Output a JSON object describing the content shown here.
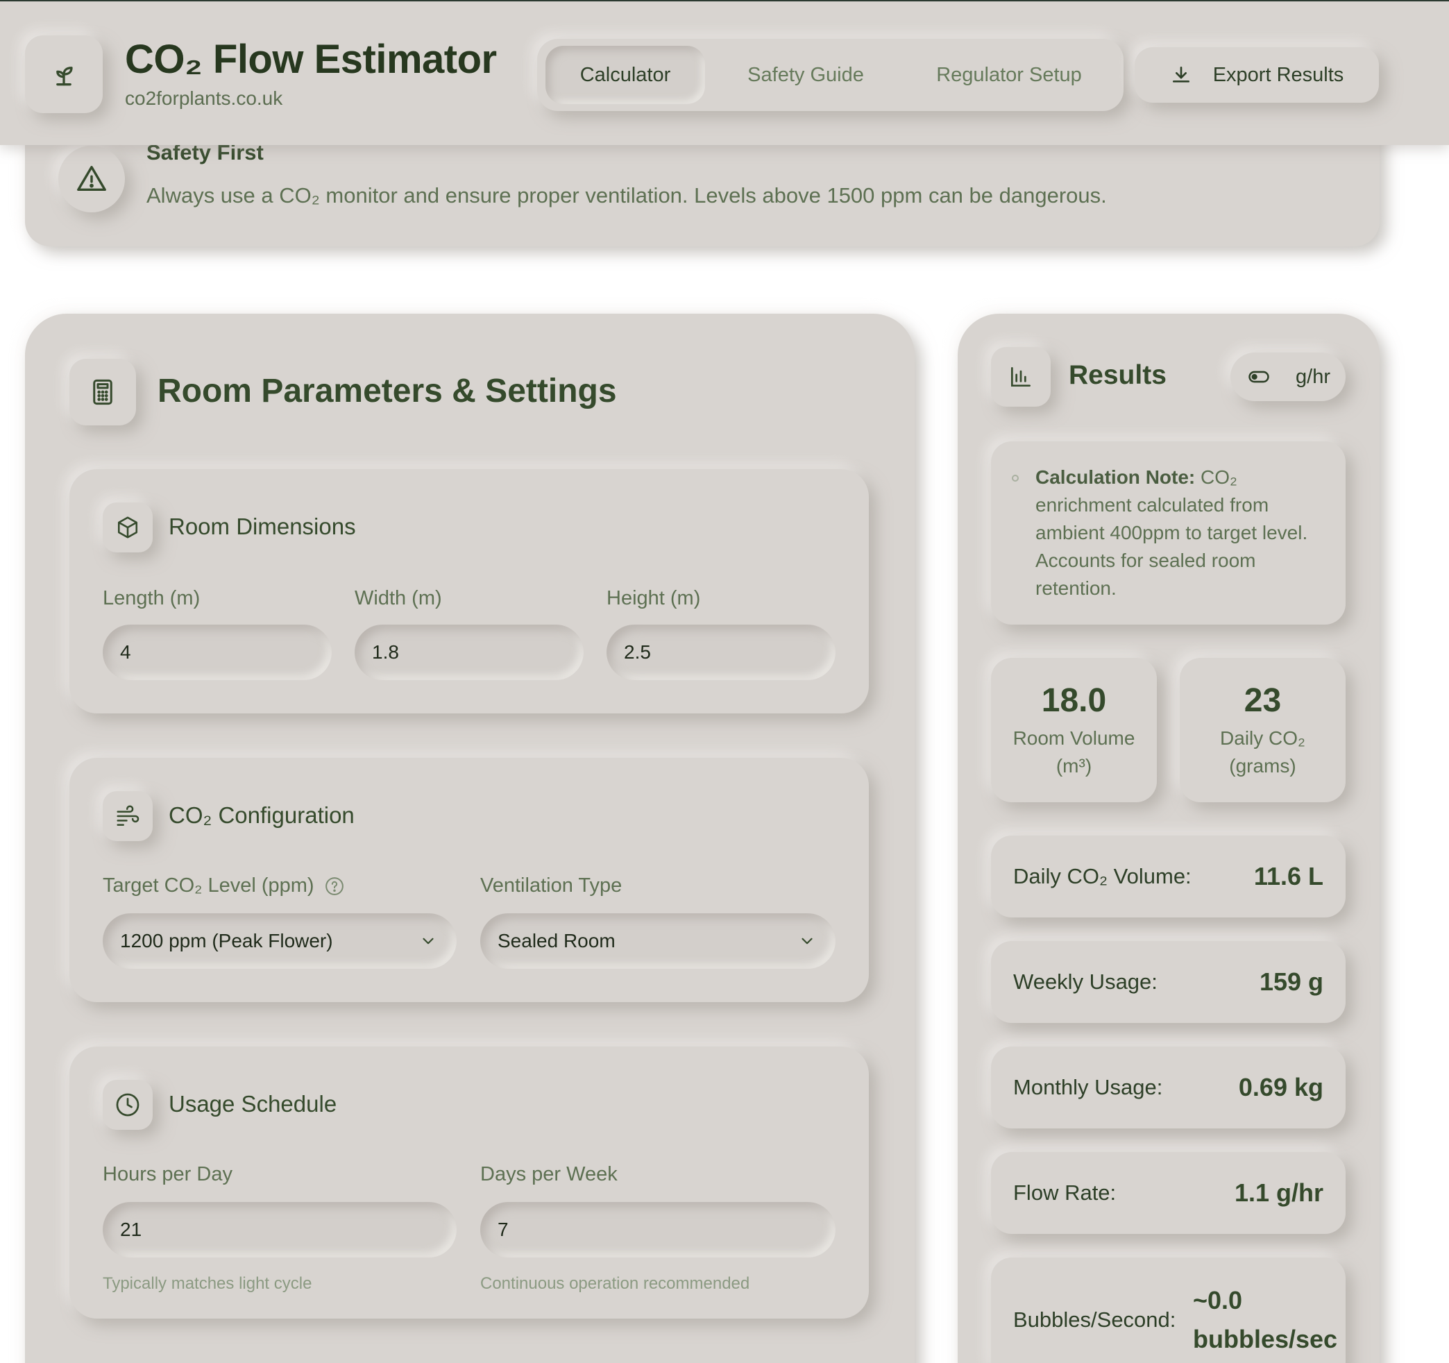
{
  "header": {
    "title": "CO₂ Flow Estimator",
    "subtitle": "co2forplants.co.uk",
    "tabs": [
      {
        "label": "Calculator",
        "active": true
      },
      {
        "label": "Safety Guide",
        "active": false
      },
      {
        "label": "Regulator Setup",
        "active": false
      }
    ],
    "export_label": "Export Results"
  },
  "safety": {
    "title": "Safety First",
    "text": "Always use a CO₂ monitor and ensure proper ventilation. Levels above 1500 ppm can be dangerous."
  },
  "main": {
    "title": "Room Parameters & Settings",
    "dimensions": {
      "title": "Room Dimensions",
      "length_label": "Length (m)",
      "length_value": "4",
      "width_label": "Width (m)",
      "width_value": "1.8",
      "height_label": "Height (m)",
      "height_value": "2.5"
    },
    "co2": {
      "title": "CO₂ Configuration",
      "target_label": "Target CO₂ Level (ppm)",
      "target_value": "1200 ppm (Peak Flower)",
      "ventilation_label": "Ventilation Type",
      "ventilation_value": "Sealed Room"
    },
    "schedule": {
      "title": "Usage Schedule",
      "hours_label": "Hours per Day",
      "hours_value": "21",
      "hours_hint": "Typically matches light cycle",
      "days_label": "Days per Week",
      "days_value": "7",
      "days_hint": "Continuous operation recommended"
    }
  },
  "results": {
    "title": "Results",
    "unit_toggle": "g/hr",
    "note_bold": "Calculation Note:",
    "note_text": " CO₂ enrichment calculated from ambient 400ppm to target level. Accounts for sealed room retention.",
    "room_volume_value": "18.0",
    "room_volume_label": "Room Volume (m³)",
    "daily_co2_value": "23",
    "daily_co2_label": "Daily CO₂ (grams)",
    "rows": [
      {
        "label": "Daily CO₂ Volume:",
        "value": "11.6 L"
      },
      {
        "label": "Weekly Usage:",
        "value": "159 g"
      },
      {
        "label": "Monthly Usage:",
        "value": "0.69 kg"
      },
      {
        "label": "Flow Rate:",
        "value": "1.1 g/hr"
      },
      {
        "label": "Bubbles/Second:",
        "value": "~0.0 bubbles/sec"
      }
    ]
  },
  "colors": {
    "surface": "#d8d4d0",
    "text_dark": "#354a2c",
    "text_muted": "#5d7052",
    "hint": "#8b9a82"
  }
}
